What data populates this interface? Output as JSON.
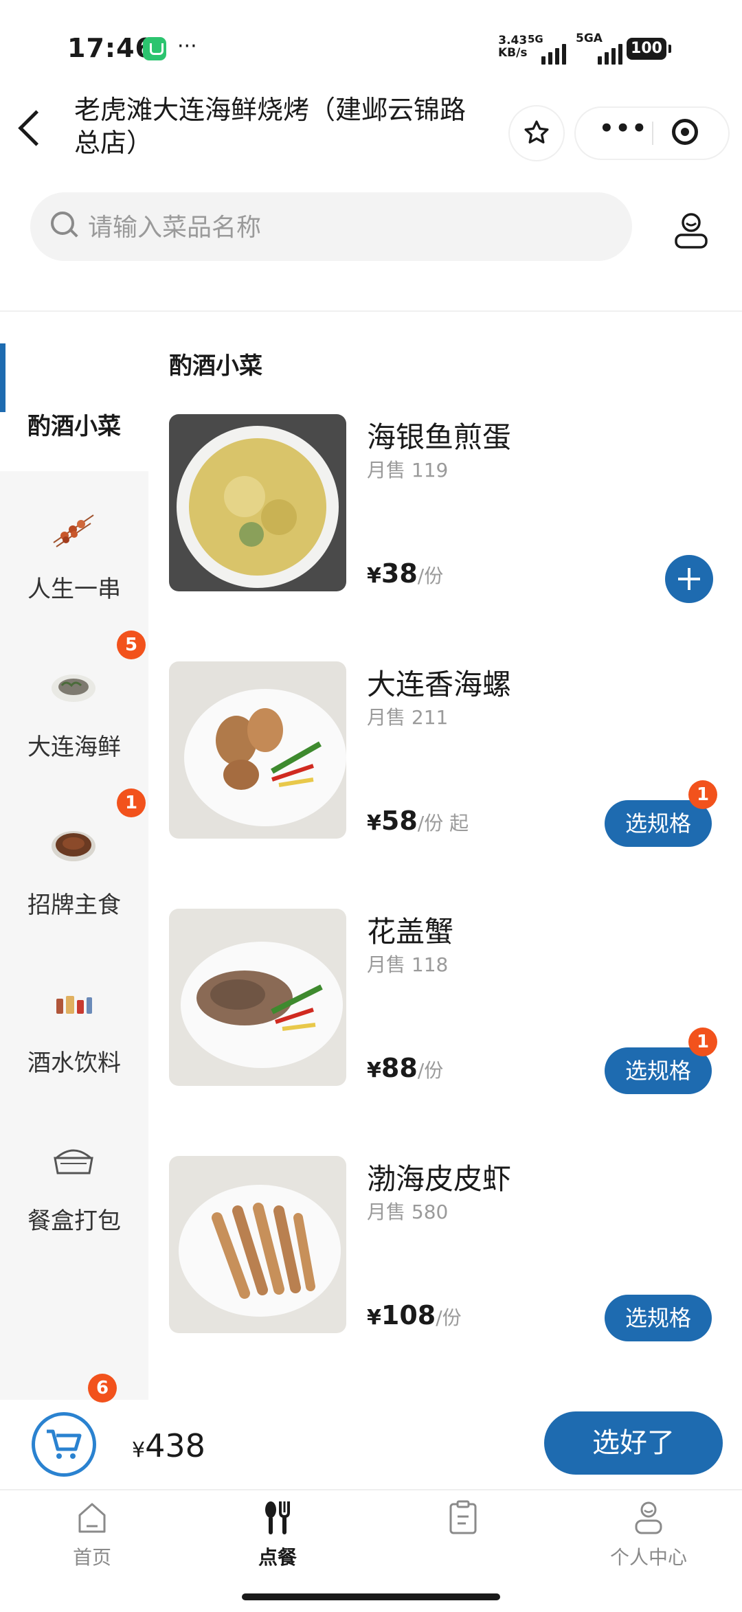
{
  "status_bar": {
    "time": "17:46",
    "dots": "···",
    "net_speed_value": "3.43",
    "net_speed_unit": "KB/s",
    "signal1_label": "5G",
    "signal2_label": "5GA",
    "battery": "100"
  },
  "header": {
    "title": "老虎滩大连海鲜烧烤（建邺云锦路总店）",
    "capsule_more": "•••"
  },
  "search": {
    "placeholder": "请输入菜品名称"
  },
  "sidebar": {
    "active_label": "酌酒小菜",
    "items": [
      {
        "label": "人生一串",
        "badge": ""
      },
      {
        "label": "大连海鲜",
        "badge": "5"
      },
      {
        "label": "招牌主食",
        "badge": "1"
      },
      {
        "label": "酒水饮料",
        "badge": ""
      },
      {
        "label": "餐盒打包",
        "badge": ""
      }
    ]
  },
  "section": {
    "heading": "酌酒小菜"
  },
  "dishes": [
    {
      "name": "海银鱼煎蛋",
      "sales": "月售 119",
      "currency": "¥",
      "price": "38",
      "unit": "/份",
      "action": "add"
    },
    {
      "name": "大连香海螺",
      "sales": "月售 211",
      "currency": "¥",
      "price": "58",
      "unit": "/份 起",
      "action": "选规格",
      "badge": "1"
    },
    {
      "name": "花盖蟹",
      "sales": "月售 118",
      "currency": "¥",
      "price": "88",
      "unit": "/份",
      "action": "选规格",
      "badge": "1"
    },
    {
      "name": "渤海皮皮虾",
      "sales": "月售 580",
      "currency": "¥",
      "price": "108",
      "unit": "/份",
      "action": "选规格"
    }
  ],
  "cart": {
    "count": "6",
    "currency": "¥",
    "total": "438",
    "checkout_label": "选好了"
  },
  "tabbar": {
    "tabs": [
      {
        "label": "首页"
      },
      {
        "label": "点餐"
      },
      {
        "label": ""
      },
      {
        "label": "个人中心"
      }
    ]
  },
  "colors": {
    "accent": "#1e6bb0",
    "badge": "#f2521c"
  }
}
